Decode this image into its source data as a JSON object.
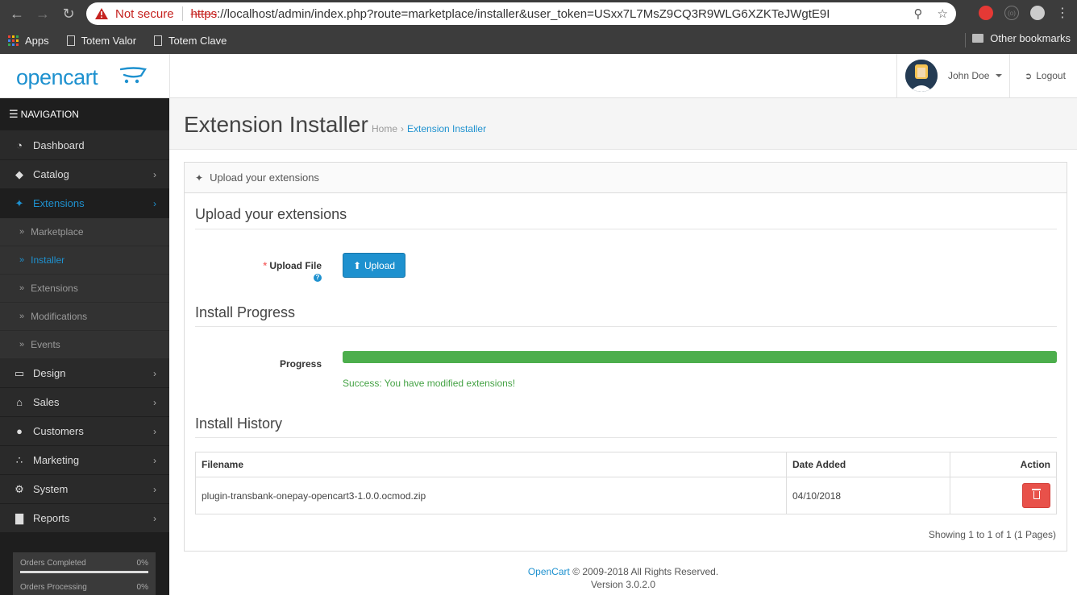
{
  "browser": {
    "not_secure": "Not secure",
    "url_scheme": "https",
    "url_rest": "://localhost/admin/index.php?route=marketplace/installer&user_token=USxx7L7MsZ9CQ3R9WLG6XZKTeJWgtE9I",
    "bookmarks": [
      "Apps",
      "Totem Valor",
      "Totem Clave"
    ],
    "other_bookmarks": "Other bookmarks"
  },
  "header": {
    "logo_text": "opencart",
    "user_name": "John Doe",
    "logout": "Logout"
  },
  "sidebar": {
    "title": "NAVIGATION",
    "items": [
      {
        "label": "Dashboard",
        "icon": "dashboard-icon",
        "arrow": false
      },
      {
        "label": "Catalog",
        "icon": "tags-icon",
        "arrow": true
      },
      {
        "label": "Extensions",
        "icon": "puzzle-icon",
        "arrow": true,
        "active": true
      },
      {
        "label": "Design",
        "icon": "monitor-icon",
        "arrow": true
      },
      {
        "label": "Sales",
        "icon": "cart-icon",
        "arrow": true
      },
      {
        "label": "Customers",
        "icon": "user-icon",
        "arrow": true
      },
      {
        "label": "Marketing",
        "icon": "share-icon",
        "arrow": true
      },
      {
        "label": "System",
        "icon": "gear-icon",
        "arrow": true
      },
      {
        "label": "Reports",
        "icon": "bar-chart-icon",
        "arrow": true
      }
    ],
    "sub_items": [
      "Marketplace",
      "Installer",
      "Extensions",
      "Modifications",
      "Events"
    ],
    "stats": [
      {
        "label": "Orders Completed",
        "value": "0%"
      },
      {
        "label": "Orders Processing",
        "value": "0%"
      }
    ]
  },
  "page": {
    "title": "Extension Installer",
    "breadcrumb": [
      "Home",
      "Extension Installer"
    ],
    "panel_heading": "Upload your extensions",
    "section_upload": "Upload your extensions",
    "upload_label": "Upload File",
    "upload_button": "Upload",
    "section_progress": "Install Progress",
    "progress_label": "Progress",
    "progress_percent": 100,
    "success_message": "Success: You have modified extensions!",
    "section_history": "Install History",
    "table": {
      "headers": [
        "Filename",
        "Date Added",
        "Action"
      ],
      "rows": [
        {
          "filename": "plugin-transbank-onepay-opencart3-1.0.0.ocmod.zip",
          "date_added": "04/10/2018"
        }
      ]
    },
    "pagination": "Showing 1 to 1 of 1 (1 Pages)"
  },
  "footer": {
    "link": "OpenCart",
    "copyright": "© 2009-2018 All Rights Reserved.",
    "version": "Version 3.0.2.0"
  },
  "colors": {
    "accent": "#1e91cf",
    "sidebar_bg": "#1e1e1e",
    "success": "#4cae4c",
    "danger": "#e8514a"
  }
}
